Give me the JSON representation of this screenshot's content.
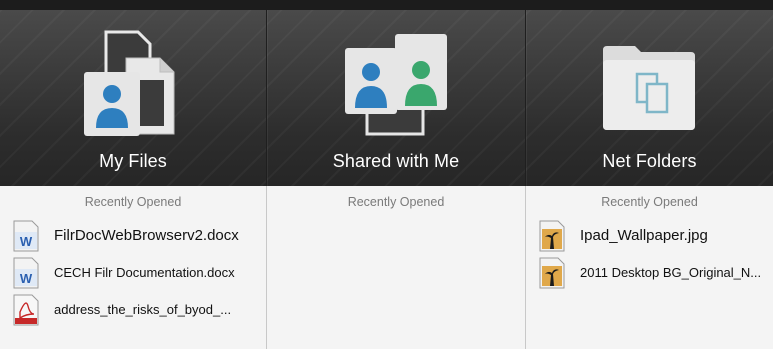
{
  "tiles": [
    {
      "label": "My Files",
      "icon": "my-files-icon"
    },
    {
      "label": "Shared with Me",
      "icon": "shared-users-icon"
    },
    {
      "label": "Net Folders",
      "icon": "net-folder-icon"
    }
  ],
  "recent": {
    "my_files": {
      "heading": "Recently Opened",
      "items": [
        {
          "name": "FilrDocWebBrowserv2.docx",
          "icon": "word-doc-icon"
        },
        {
          "name": "CECH Filr Documentation.docx",
          "icon": "word-doc-icon"
        },
        {
          "name": "address_the_risks_of_byod_...",
          "icon": "pdf-icon"
        }
      ]
    },
    "shared": {
      "heading": "Recently Opened",
      "items": []
    },
    "net_folders": {
      "heading": "Recently Opened",
      "items": [
        {
          "name": "Ipad_Wallpaper.jpg",
          "icon": "image-file-icon"
        },
        {
          "name": "2011 Desktop BG_Original_N...",
          "icon": "image-file-icon"
        }
      ]
    }
  },
  "colors": {
    "user_blue": "#2e7fbf",
    "user_green": "#3aa76d",
    "tile_bg": "#3a3a3a"
  }
}
